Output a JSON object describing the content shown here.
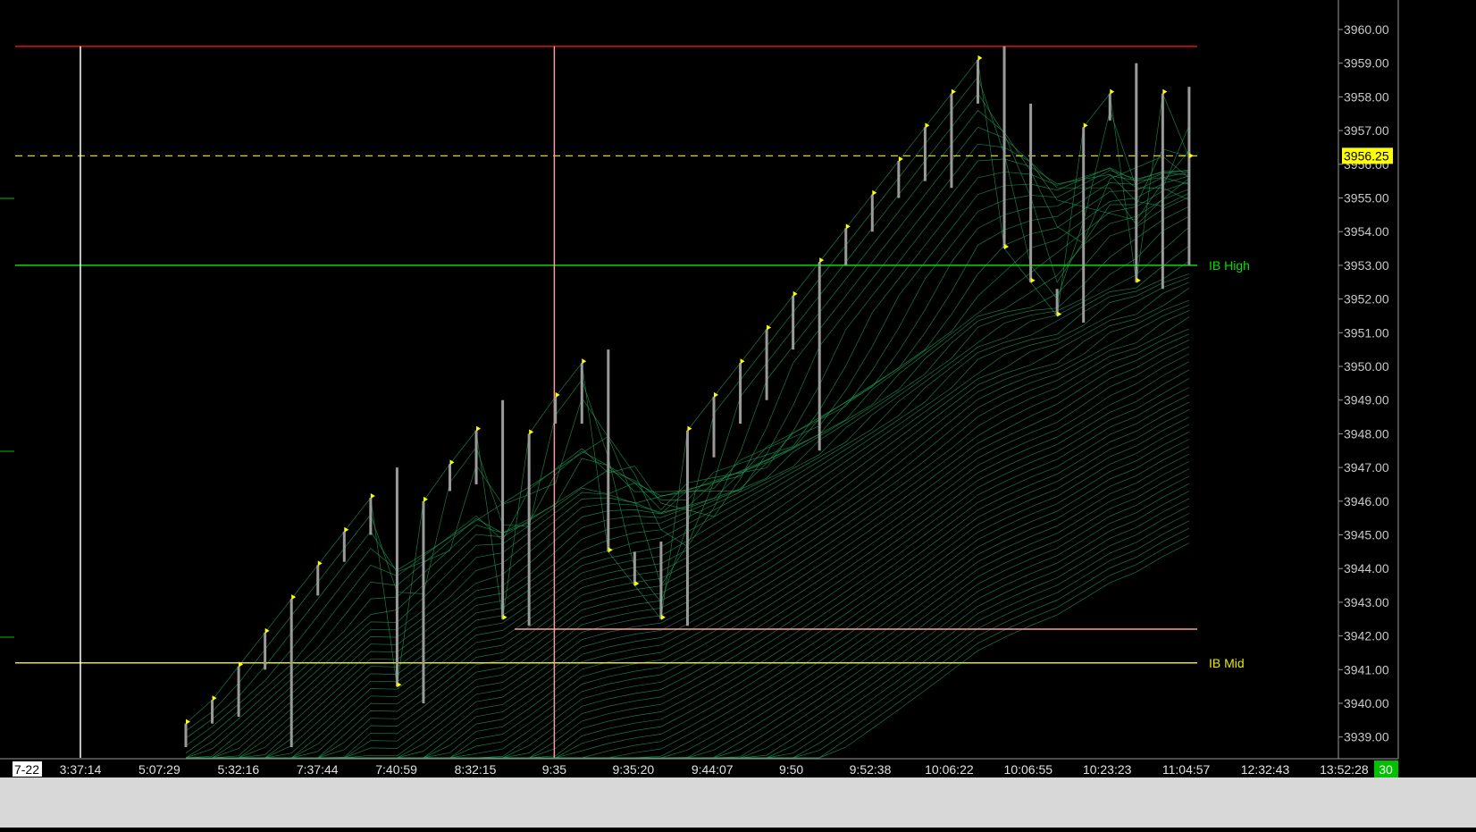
{
  "chart_data": {
    "type": "line",
    "ylim": [
      3938.7,
      3961.0
    ],
    "y_ticks": [
      "3939.00",
      "3940.00",
      "3941.00",
      "3942.00",
      "3943.00",
      "3944.00",
      "3945.00",
      "3946.00",
      "3947.00",
      "3948.00",
      "3949.00",
      "3950.00",
      "3951.00",
      "3952.00",
      "3953.00",
      "3954.00",
      "3955.00",
      "3956.00",
      "3957.00",
      "3958.00",
      "3959.00",
      "3960.00"
    ],
    "x_labels": [
      "3:37:14",
      "5:07:29",
      "5:32:16",
      "7:37:44",
      "7:40:59",
      "8:32:15",
      "9:35",
      "9:35:20",
      "9:44:07",
      "9:50",
      "9:52:38",
      "10:06:22",
      "10:06:55",
      "10:23:23",
      "11:04:57",
      "12:32:43",
      "13:52:28"
    ],
    "date_label": "7-22",
    "corner_value": "30",
    "last_price": {
      "value": 3956.25,
      "label": "3956.25"
    },
    "reference_lines": [
      {
        "name": "high",
        "value": 3959.5,
        "color": "#e01010"
      },
      {
        "name": "IB High",
        "value": 3953.0,
        "color": "#00e000",
        "label": "IB High"
      },
      {
        "name": "IB Mid",
        "value": 3941.2,
        "color": "#e8e800",
        "label": "IB Mid"
      },
      {
        "name": "low",
        "value": 3942.2,
        "color": "#ff9a9a"
      }
    ],
    "vertical_markers": [
      {
        "at_label": "3:37:14",
        "color": "#ffffff"
      },
      {
        "at_label": "9:35",
        "color": "#ff9a9a"
      }
    ],
    "bars": [
      {
        "low": 3938.7,
        "high": 3939.4,
        "close": 3939.4
      },
      {
        "low": 3939.4,
        "high": 3940.1,
        "close": 3940.1
      },
      {
        "low": 3939.6,
        "high": 3941.1,
        "close": 3941.1
      },
      {
        "low": 3941.0,
        "high": 3942.1,
        "close": 3942.1
      },
      {
        "low": 3938.7,
        "high": 3943.1,
        "close": 3943.1
      },
      {
        "low": 3943.2,
        "high": 3944.1,
        "close": 3944.1
      },
      {
        "low": 3944.2,
        "high": 3945.1,
        "close": 3945.1
      },
      {
        "low": 3945.0,
        "high": 3946.1,
        "close": 3946.1
      },
      {
        "low": 3940.5,
        "high": 3947.0,
        "close": 3940.5
      },
      {
        "low": 3940.0,
        "high": 3946.0,
        "close": 3946.0
      },
      {
        "low": 3946.3,
        "high": 3947.1,
        "close": 3947.1
      },
      {
        "low": 3946.5,
        "high": 3948.1,
        "close": 3948.1
      },
      {
        "low": 3942.5,
        "high": 3949.0,
        "close": 3942.5
      },
      {
        "low": 3942.3,
        "high": 3948.0,
        "close": 3948.0
      },
      {
        "low": 3948.3,
        "high": 3949.1,
        "close": 3949.1
      },
      {
        "low": 3948.3,
        "high": 3950.1,
        "close": 3950.1
      },
      {
        "low": 3944.5,
        "high": 3950.5,
        "close": 3944.5
      },
      {
        "low": 3943.5,
        "high": 3944.5,
        "close": 3943.5
      },
      {
        "low": 3942.5,
        "high": 3944.8,
        "close": 3942.5
      },
      {
        "low": 3942.3,
        "high": 3948.1,
        "close": 3948.1
      },
      {
        "low": 3947.3,
        "high": 3949.1,
        "close": 3949.1
      },
      {
        "low": 3948.3,
        "high": 3950.1,
        "close": 3950.1
      },
      {
        "low": 3949.0,
        "high": 3951.1,
        "close": 3951.1
      },
      {
        "low": 3950.5,
        "high": 3952.1,
        "close": 3952.1
      },
      {
        "low": 3947.5,
        "high": 3953.1,
        "close": 3953.1
      },
      {
        "low": 3953.0,
        "high": 3954.1,
        "close": 3954.1
      },
      {
        "low": 3954.0,
        "high": 3955.1,
        "close": 3955.1
      },
      {
        "low": 3955.0,
        "high": 3956.1,
        "close": 3956.1
      },
      {
        "low": 3955.5,
        "high": 3957.1,
        "close": 3957.1
      },
      {
        "low": 3955.3,
        "high": 3958.1,
        "close": 3958.1
      },
      {
        "low": 3957.8,
        "high": 3959.1,
        "close": 3959.1
      },
      {
        "low": 3953.5,
        "high": 3959.5,
        "close": 3953.5
      },
      {
        "low": 3952.5,
        "high": 3957.8,
        "close": 3952.5
      },
      {
        "low": 3951.5,
        "high": 3952.3,
        "close": 3951.5
      },
      {
        "low": 3951.3,
        "high": 3957.1,
        "close": 3957.1
      },
      {
        "low": 3957.3,
        "high": 3958.1,
        "close": 3958.1
      },
      {
        "low": 3952.5,
        "high": 3959.0,
        "close": 3952.5
      },
      {
        "low": 3952.3,
        "high": 3958.1,
        "close": 3958.1
      },
      {
        "low": 3953.0,
        "high": 3958.3,
        "close": 3956.2
      }
    ]
  }
}
